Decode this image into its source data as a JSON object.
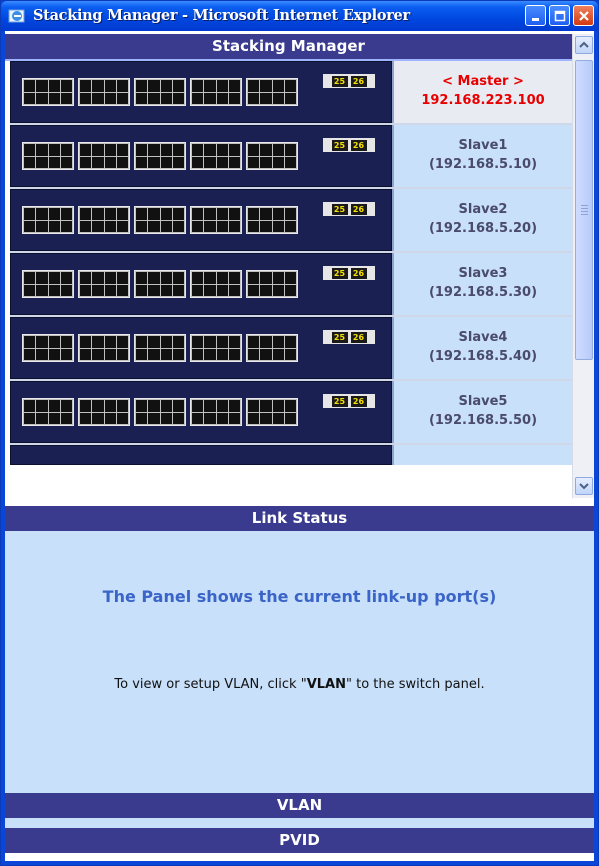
{
  "window": {
    "title": "Stacking Manager - Microsoft Internet Explorer"
  },
  "frame": {
    "header": "Stacking Manager"
  },
  "units": [
    {
      "label": "< Master >",
      "ip": "192.168.223.100",
      "role": "master"
    },
    {
      "label": "Slave1",
      "ip": "(192.168.5.10)",
      "role": "slave"
    },
    {
      "label": "Slave2",
      "ip": "(192.168.5.20)",
      "role": "slave"
    },
    {
      "label": "Slave3",
      "ip": "(192.168.5.30)",
      "role": "slave"
    },
    {
      "label": "Slave4",
      "ip": "(192.168.5.40)",
      "role": "slave"
    },
    {
      "label": "Slave5",
      "ip": "(192.168.5.50)",
      "role": "slave"
    }
  ],
  "sfp_ports": [
    "25",
    "26"
  ],
  "link_status": {
    "header": "Link Status",
    "message": "The Panel shows the current link-up port(s)",
    "note_before": "To view or setup VLAN, click \"",
    "note_keyword": "VLAN",
    "note_after": "\" to the switch panel."
  },
  "sections": {
    "vlan": "VLAN",
    "pvid": "PVID"
  },
  "colors": {
    "section_header": "#3a3a8f",
    "panel_bg": "#1a2052",
    "label_bg": "#c8e0fa",
    "master_text": "#e80000"
  }
}
